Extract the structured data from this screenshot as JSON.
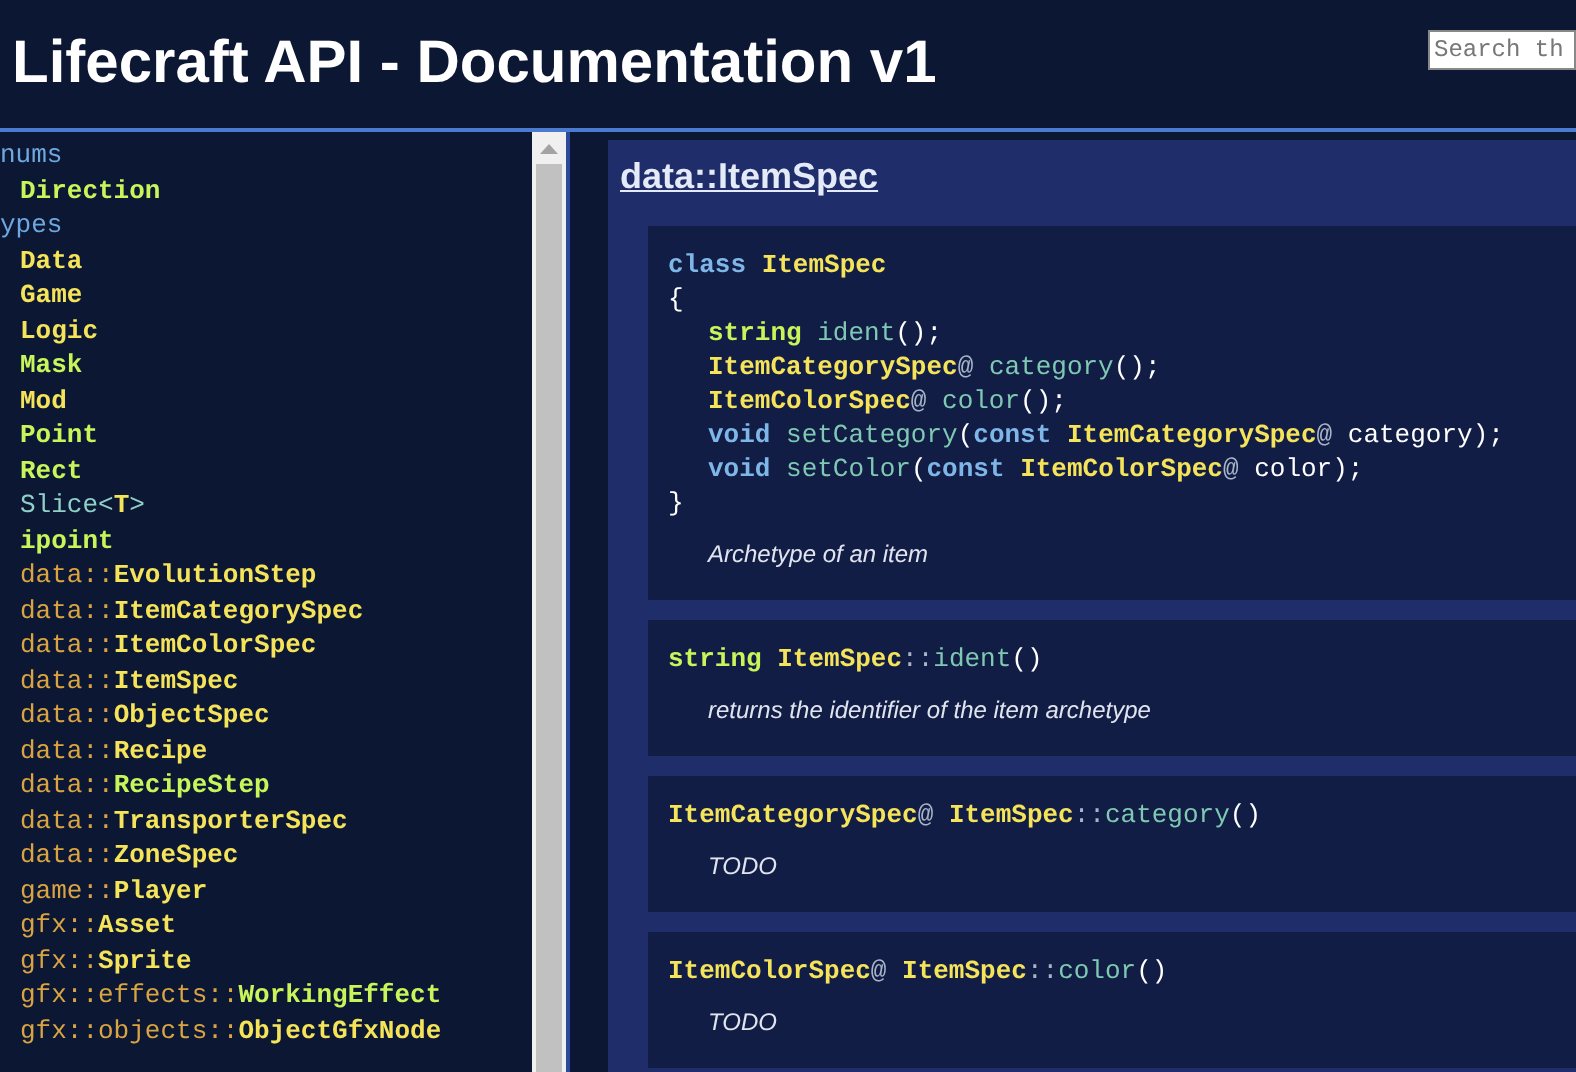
{
  "header": {
    "title": "Lifecraft API - Documentation v1",
    "search": {
      "placeholder": "Search th"
    }
  },
  "sidebar": {
    "items": [
      {
        "kind": "group",
        "parts": [
          {
            "kind": "label",
            "text": "nums"
          }
        ]
      },
      {
        "kind": "entry",
        "parts": [
          {
            "kind": "struct",
            "text": "Direction"
          }
        ]
      },
      {
        "kind": "group",
        "parts": [
          {
            "kind": "label",
            "text": "ypes"
          }
        ]
      },
      {
        "kind": "entry",
        "parts": [
          {
            "kind": "class",
            "text": "Data"
          }
        ]
      },
      {
        "kind": "entry",
        "parts": [
          {
            "kind": "class",
            "text": "Game"
          }
        ]
      },
      {
        "kind": "entry",
        "parts": [
          {
            "kind": "class",
            "text": "Logic"
          }
        ]
      },
      {
        "kind": "entry",
        "parts": [
          {
            "kind": "struct",
            "text": "Mask"
          }
        ]
      },
      {
        "kind": "entry",
        "parts": [
          {
            "kind": "class",
            "text": "Mod"
          }
        ]
      },
      {
        "kind": "entry",
        "parts": [
          {
            "kind": "struct",
            "text": "Point"
          }
        ]
      },
      {
        "kind": "entry",
        "parts": [
          {
            "kind": "struct",
            "text": "Rect"
          }
        ]
      },
      {
        "kind": "entry",
        "parts": [
          {
            "kind": "generic",
            "text": "Slice<"
          },
          {
            "kind": "class",
            "text": "T"
          },
          {
            "kind": "generic",
            "text": ">"
          }
        ]
      },
      {
        "kind": "entry",
        "parts": [
          {
            "kind": "struct",
            "text": "ipoint"
          }
        ]
      },
      {
        "kind": "entry",
        "parts": [
          {
            "kind": "ns",
            "text": "data::"
          },
          {
            "kind": "class",
            "text": "EvolutionStep"
          }
        ]
      },
      {
        "kind": "entry",
        "parts": [
          {
            "kind": "ns",
            "text": "data::"
          },
          {
            "kind": "class",
            "text": "ItemCategorySpec"
          }
        ]
      },
      {
        "kind": "entry",
        "parts": [
          {
            "kind": "ns",
            "text": "data::"
          },
          {
            "kind": "class",
            "text": "ItemColorSpec"
          }
        ]
      },
      {
        "kind": "entry",
        "parts": [
          {
            "kind": "ns",
            "text": "data::"
          },
          {
            "kind": "class",
            "text": "ItemSpec"
          }
        ]
      },
      {
        "kind": "entry",
        "parts": [
          {
            "kind": "ns",
            "text": "data::"
          },
          {
            "kind": "class",
            "text": "ObjectSpec"
          }
        ]
      },
      {
        "kind": "entry",
        "parts": [
          {
            "kind": "ns",
            "text": "data::"
          },
          {
            "kind": "class",
            "text": "Recipe"
          }
        ]
      },
      {
        "kind": "entry",
        "parts": [
          {
            "kind": "ns",
            "text": "data::"
          },
          {
            "kind": "struct",
            "text": "RecipeStep"
          }
        ]
      },
      {
        "kind": "entry",
        "parts": [
          {
            "kind": "ns",
            "text": "data::"
          },
          {
            "kind": "class",
            "text": "TransporterSpec"
          }
        ]
      },
      {
        "kind": "entry",
        "parts": [
          {
            "kind": "ns",
            "text": "data::"
          },
          {
            "kind": "class",
            "text": "ZoneSpec"
          }
        ]
      },
      {
        "kind": "entry",
        "parts": [
          {
            "kind": "ns",
            "text": "game::"
          },
          {
            "kind": "class",
            "text": "Player"
          }
        ]
      },
      {
        "kind": "entry",
        "parts": [
          {
            "kind": "ns",
            "text": "gfx::"
          },
          {
            "kind": "class",
            "text": "Asset"
          }
        ]
      },
      {
        "kind": "entry",
        "parts": [
          {
            "kind": "ns",
            "text": "gfx::"
          },
          {
            "kind": "class",
            "text": "Sprite"
          }
        ]
      },
      {
        "kind": "entry",
        "parts": [
          {
            "kind": "ns",
            "text": "gfx::effects::"
          },
          {
            "kind": "struct",
            "text": "WorkingEffect"
          }
        ]
      },
      {
        "kind": "entry",
        "parts": [
          {
            "kind": "ns",
            "text": "gfx::objects::"
          },
          {
            "kind": "class",
            "text": "ObjectGfxNode"
          }
        ]
      }
    ]
  },
  "main": {
    "title": "data::ItemSpec",
    "blocks": [
      {
        "lines": [
          {
            "indent": false,
            "tokens": [
              {
                "kind": "keyword",
                "text": "class "
              },
              {
                "kind": "type",
                "text": "ItemSpec"
              }
            ]
          },
          {
            "indent": false,
            "tokens": [
              {
                "kind": "punct",
                "text": "{"
              }
            ]
          },
          {
            "indent": true,
            "tokens": [
              {
                "kind": "builtin",
                "text": "string "
              },
              {
                "kind": "method",
                "text": "ident"
              },
              {
                "kind": "punct",
                "text": "();"
              }
            ]
          },
          {
            "indent": true,
            "tokens": [
              {
                "kind": "type",
                "text": "ItemCategorySpec"
              },
              {
                "kind": "scope",
                "text": "@ "
              },
              {
                "kind": "method",
                "text": "category"
              },
              {
                "kind": "punct",
                "text": "();"
              }
            ]
          },
          {
            "indent": true,
            "tokens": [
              {
                "kind": "type",
                "text": "ItemColorSpec"
              },
              {
                "kind": "scope",
                "text": "@ "
              },
              {
                "kind": "method",
                "text": "color"
              },
              {
                "kind": "punct",
                "text": "();"
              }
            ]
          },
          {
            "indent": true,
            "tokens": [
              {
                "kind": "keyword",
                "text": "void "
              },
              {
                "kind": "method",
                "text": "setCategory"
              },
              {
                "kind": "punct",
                "text": "("
              },
              {
                "kind": "keyword",
                "text": "const "
              },
              {
                "kind": "type",
                "text": "ItemCategorySpec"
              },
              {
                "kind": "scope",
                "text": "@ "
              },
              {
                "kind": "punct",
                "text": "category);"
              }
            ]
          },
          {
            "indent": true,
            "tokens": [
              {
                "kind": "keyword",
                "text": "void "
              },
              {
                "kind": "method",
                "text": "setColor"
              },
              {
                "kind": "punct",
                "text": "("
              },
              {
                "kind": "keyword",
                "text": "const "
              },
              {
                "kind": "type",
                "text": "ItemColorSpec"
              },
              {
                "kind": "scope",
                "text": "@ "
              },
              {
                "kind": "punct",
                "text": "color);"
              }
            ]
          },
          {
            "indent": false,
            "tokens": [
              {
                "kind": "punct",
                "text": "}"
              }
            ]
          }
        ],
        "description": "Archetype of an item"
      },
      {
        "lines": [
          {
            "indent": false,
            "tokens": [
              {
                "kind": "builtin",
                "text": "string "
              },
              {
                "kind": "type",
                "text": "ItemSpec"
              },
              {
                "kind": "scope",
                "text": "::"
              },
              {
                "kind": "method",
                "text": "ident"
              },
              {
                "kind": "punct",
                "text": "()"
              }
            ]
          }
        ],
        "description": "returns the identifier of the item archetype"
      },
      {
        "lines": [
          {
            "indent": false,
            "tokens": [
              {
                "kind": "type",
                "text": "ItemCategorySpec"
              },
              {
                "kind": "scope",
                "text": "@ "
              },
              {
                "kind": "type",
                "text": "ItemSpec"
              },
              {
                "kind": "scope",
                "text": "::"
              },
              {
                "kind": "method",
                "text": "category"
              },
              {
                "kind": "punct",
                "text": "()"
              }
            ]
          }
        ],
        "description": "TODO"
      },
      {
        "lines": [
          {
            "indent": false,
            "tokens": [
              {
                "kind": "type",
                "text": "ItemColorSpec"
              },
              {
                "kind": "scope",
                "text": "@ "
              },
              {
                "kind": "type",
                "text": "ItemSpec"
              },
              {
                "kind": "scope",
                "text": "::"
              },
              {
                "kind": "method",
                "text": "color"
              },
              {
                "kind": "punct",
                "text": "()"
              }
            ]
          }
        ],
        "description": "TODO"
      }
    ]
  }
}
